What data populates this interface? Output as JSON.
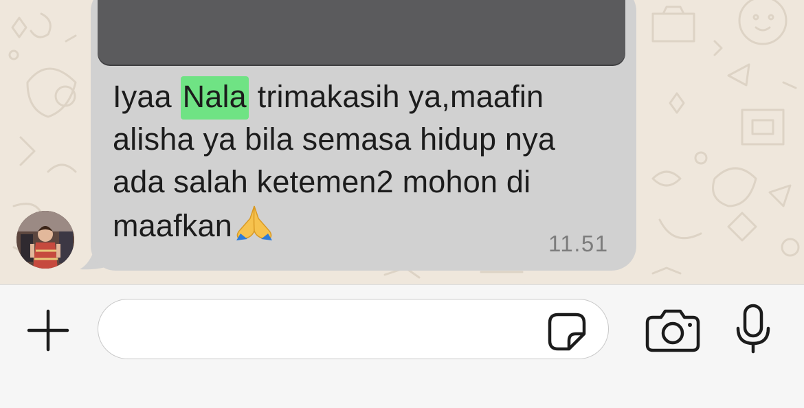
{
  "chat": {
    "message": {
      "lines": [
        {
          "before": "Iyaa ",
          "highlight": "Nala",
          "after": " trimakasih ya,maafin"
        },
        {
          "text": "alisha ya bila semasa hidup nya"
        },
        {
          "text": "ada salah ketemen2 mohon di"
        },
        {
          "text": "maafkan"
        }
      ],
      "emoji": "folded-hands-emoji",
      "time": "11.51"
    },
    "bubble_color": "#d1d1d1",
    "highlight_color": "#6fe384",
    "wallpaper_color": "#efe7dc"
  },
  "input_bar": {
    "plus_icon": "plus-icon",
    "message_placeholder": "",
    "sticker_icon": "sticker-icon",
    "camera_icon": "camera-icon",
    "mic_icon": "microphone-icon"
  }
}
